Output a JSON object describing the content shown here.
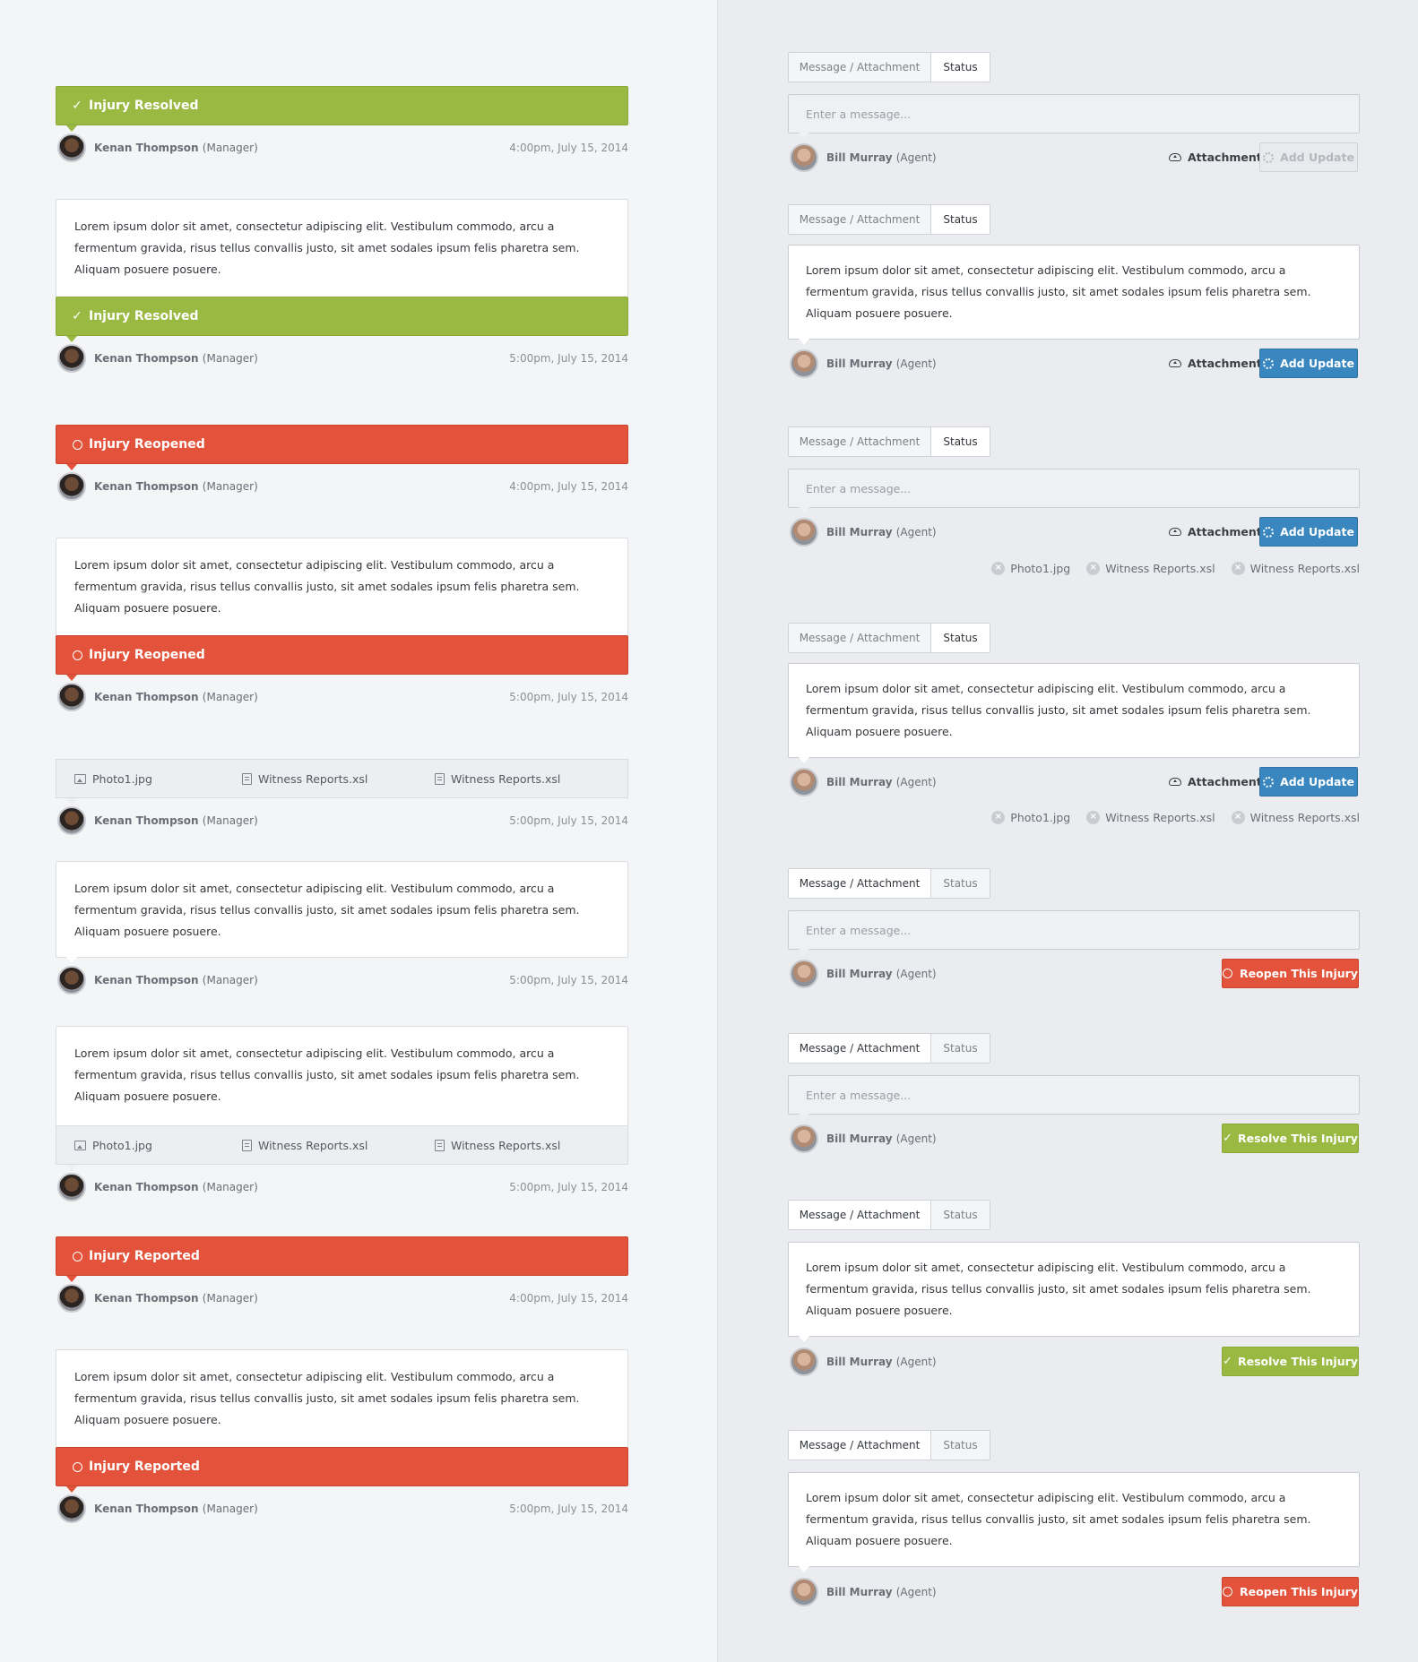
{
  "feed": {
    "manager_name": "Kenan Thompson",
    "manager_role": "(Manager)",
    "lorem": "Lorem ipsum dolor sit amet, consectetur adipiscing elit. Vestibulum commodo, arcu a fermentum gravida, risus tellus convallis justo, sit amet sodales ipsum felis pharetra sem. Aliquam posuere posuere.",
    "times": [
      "4:00pm, July 15, 2014",
      "5:00pm, July 15, 2014"
    ],
    "statuses": {
      "resolved": "Injury Resolved",
      "reopened": "Injury Reopened",
      "reported": "Injury Reported"
    },
    "files": [
      "Photo1.jpg",
      "Witness Reports.xsl",
      "Witness Reports.xsl"
    ]
  },
  "composer": {
    "tab_message": "Message / Attachment",
    "tab_status": "Status",
    "placeholder": "Enter a message...",
    "agent_name": "Bill Murray",
    "agent_role": "(Agent)",
    "attachment_label": "Attachment",
    "add_update_label": "Add Update",
    "reopen_label": "Reopen This Injury",
    "resolve_label": "Resolve This Injury",
    "lorem": "Lorem ipsum dolor sit amet, consectetur adipiscing elit. Vestibulum commodo, arcu a fermentum gravida, risus tellus convallis justo, sit amet sodales ipsum felis pharetra sem. Aliquam posuere posuere.",
    "chips": [
      "Photo1.jpg",
      "Witness Reports.xsl",
      "Witness Reports.xsl"
    ]
  },
  "colors": {
    "green": "#9ab943",
    "red": "#e3533b",
    "blue": "#3a87c0"
  }
}
